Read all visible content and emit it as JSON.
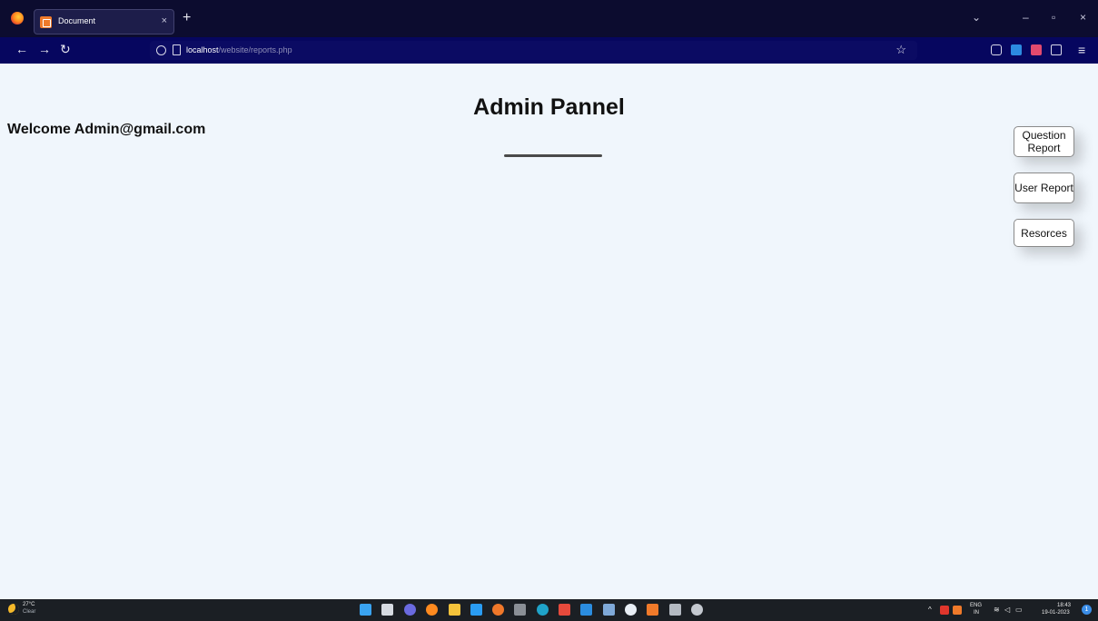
{
  "browser": {
    "tab_title": "Document",
    "tab_close": "×",
    "new_tab": "+",
    "controls": {
      "minimize": "–",
      "maximize": "▫",
      "close": "×",
      "list_all_tabs": "⌄"
    },
    "nav": {
      "back": "←",
      "forward": "→",
      "reload": "↻"
    },
    "url_host": "localhost",
    "url_path": "/website/reports.php",
    "bookmark_star": "☆",
    "menu": "≡"
  },
  "page": {
    "title": "Admin Pannel",
    "welcome": "Welcome Admin@gmail.com",
    "buttons": {
      "question_report": "Question Report",
      "user_report": "User Report",
      "resources": "Resorces"
    }
  },
  "taskbar": {
    "weather_temp": "27°C",
    "weather_condition": "Clear",
    "language_primary": "ENG",
    "language_region": "IN",
    "time": "18:43",
    "date": "19-01-2023",
    "notification_count": "1",
    "tray_overflow": "^",
    "tray_wifi": "≋",
    "tray_volume": "◁",
    "tray_battery": "▭"
  },
  "colors": {
    "page_background": "#f0f6fc",
    "tabbar_background": "#0c0c2f",
    "toolbar_background": "#06065f",
    "taskbar_background": "#1b1f24",
    "title_underline": "#4a4a4a"
  }
}
